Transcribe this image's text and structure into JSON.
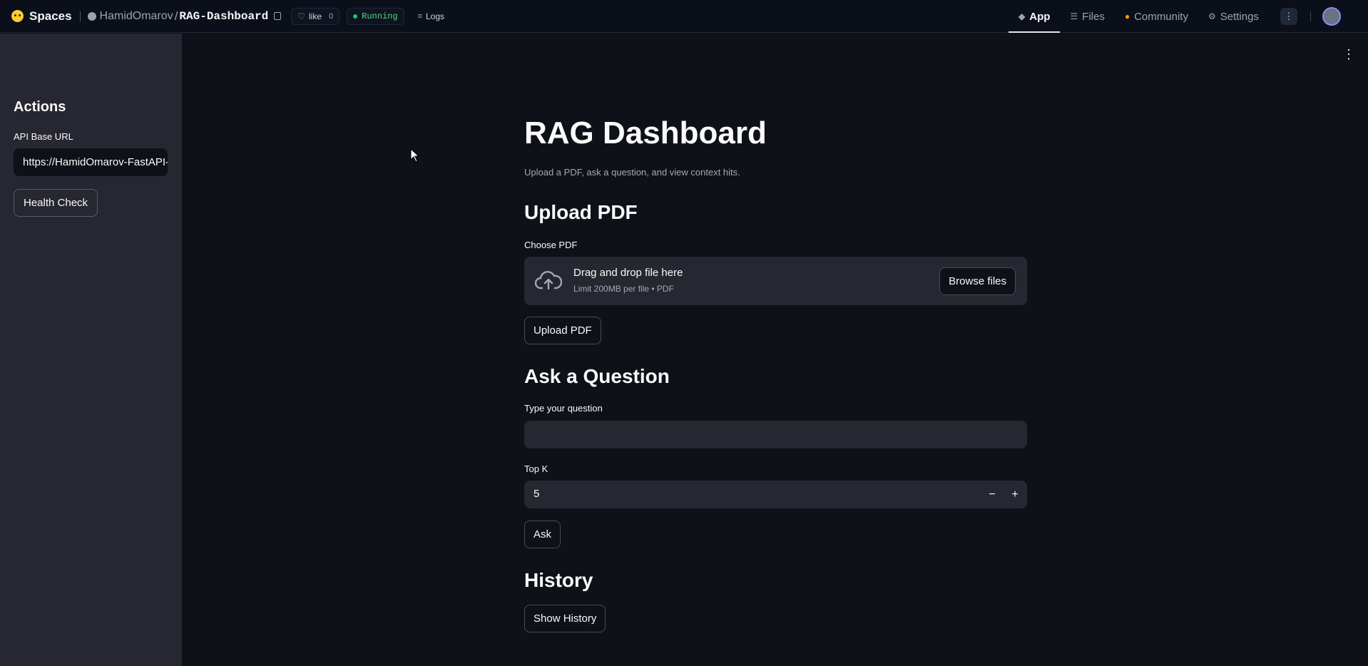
{
  "topbar": {
    "brand": "Spaces",
    "owner": "HamidOmarov",
    "separator": "/",
    "repo": "RAG-Dashboard",
    "like_label": "like",
    "like_count": "0",
    "status": "Running",
    "logs_label": "Logs",
    "nav": [
      {
        "label": "App",
        "icon": "app-icon",
        "active": true
      },
      {
        "label": "Files",
        "icon": "files-icon",
        "active": false
      },
      {
        "label": "Community",
        "icon": "community-icon",
        "active": false
      },
      {
        "label": "Settings",
        "icon": "settings-icon",
        "active": false
      }
    ]
  },
  "sidebar": {
    "title": "Actions",
    "api_label": "API Base URL",
    "api_value": "https://HamidOmarov-FastAPI-RAG-API.hf.space",
    "health_button": "Health Check"
  },
  "main": {
    "title": "RAG Dashboard",
    "caption": "Upload a PDF, ask a question, and view context hits.",
    "upload_section": {
      "heading": "Upload PDF",
      "label": "Choose PDF",
      "dropzone_title": "Drag and drop file here",
      "dropzone_limit": "Limit 200MB per file • PDF",
      "browse_button": "Browse files",
      "upload_button": "Upload PDF"
    },
    "ask_section": {
      "heading": "Ask a Question",
      "question_label": "Type your question",
      "question_value": "",
      "topk_label": "Top K",
      "topk_value": "5",
      "ask_button": "Ask"
    },
    "history_section": {
      "heading": "History",
      "show_button": "Show History"
    }
  },
  "colors": {
    "background": "#0e1117",
    "sidebar": "#262730",
    "topbar": "#0b0f19",
    "status_green": "#4ade80",
    "text": "#fafafa"
  }
}
